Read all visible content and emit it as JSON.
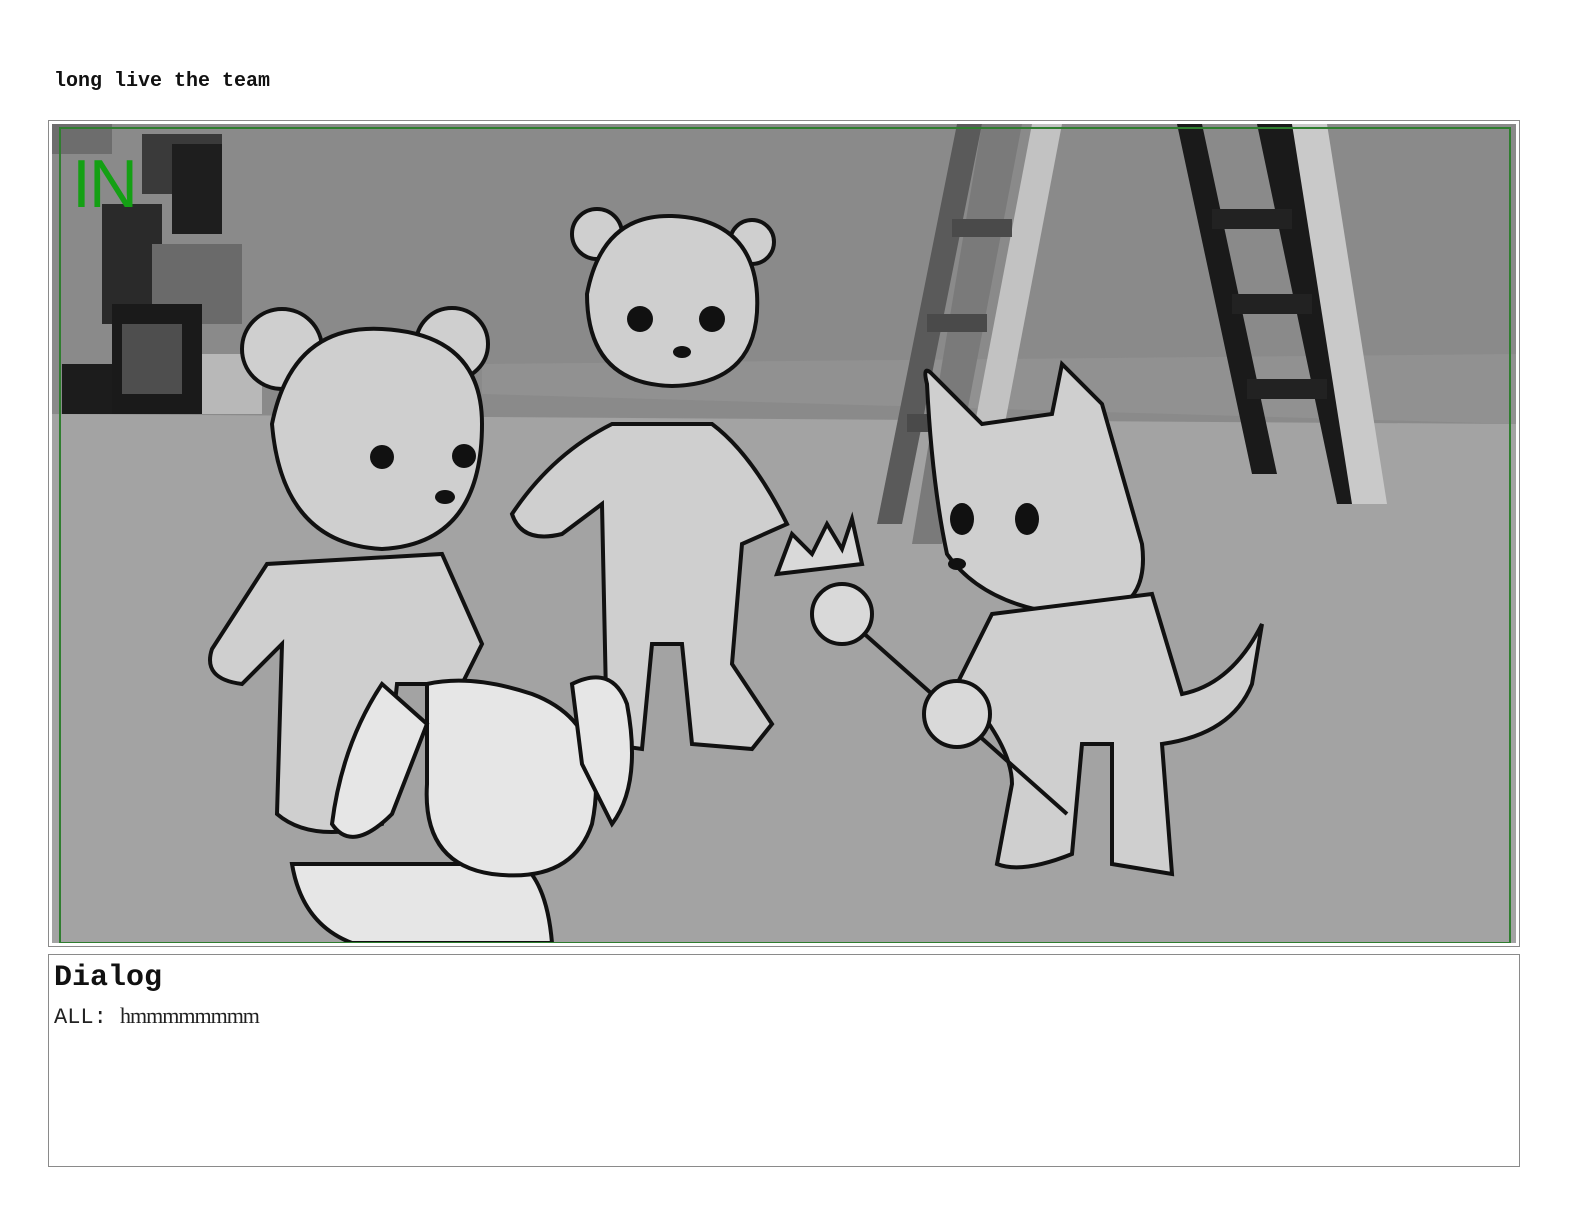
{
  "page": {
    "title": "long live the team"
  },
  "panel": {
    "marker": "IN"
  },
  "dialog": {
    "heading": "Dialog",
    "speaker": "ALL:",
    "line": "hmmmmmmmm"
  },
  "icons": [
    "storyboard-panel-image"
  ],
  "colors": {
    "marker": "#14a014",
    "safe-frame": "#2f7d2f"
  }
}
